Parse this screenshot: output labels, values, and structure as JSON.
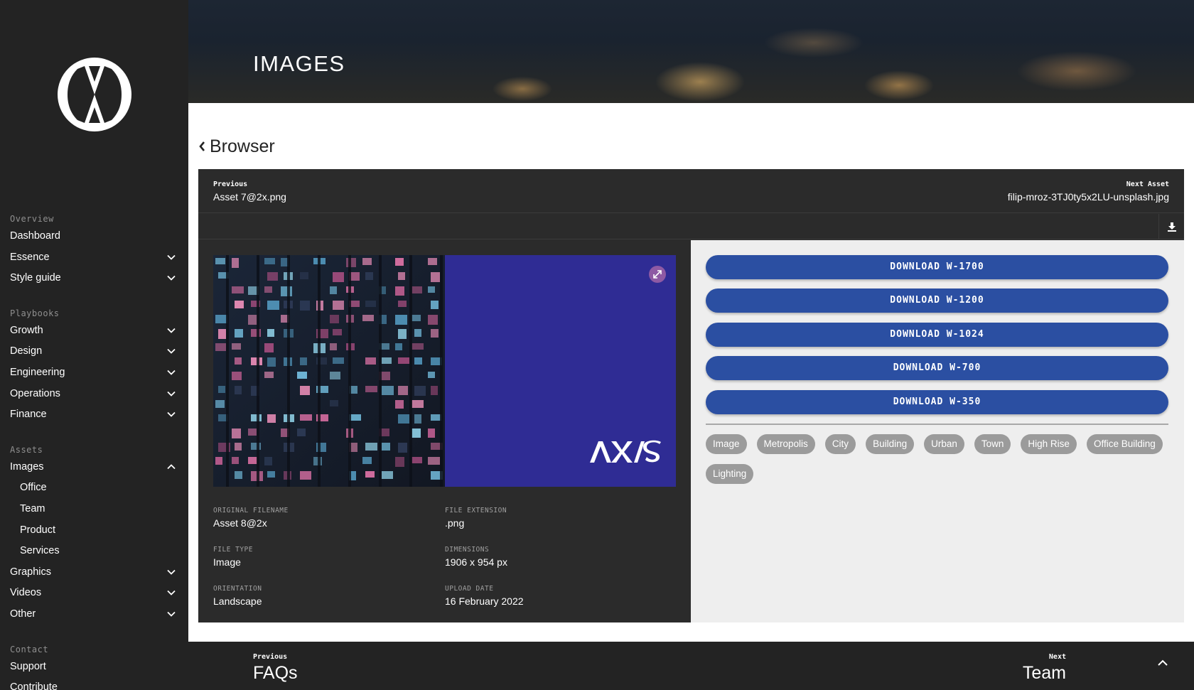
{
  "sidebar": {
    "logo": "brand-logo",
    "groups": [
      {
        "title": "Overview",
        "items": [
          {
            "label": "Dashboard",
            "chevron": ""
          },
          {
            "label": "Essence",
            "chevron": "down"
          },
          {
            "label": "Style guide",
            "chevron": "down"
          }
        ]
      },
      {
        "title": "Playbooks",
        "items": [
          {
            "label": "Growth",
            "chevron": "down"
          },
          {
            "label": "Design",
            "chevron": "down"
          },
          {
            "label": "Engineering",
            "chevron": "down"
          },
          {
            "label": "Operations",
            "chevron": "down"
          },
          {
            "label": "Finance",
            "chevron": "down"
          }
        ]
      },
      {
        "title": "Assets",
        "items": [
          {
            "label": "Images",
            "chevron": "up"
          },
          {
            "label": "Office",
            "sub": true
          },
          {
            "label": "Team",
            "sub": true
          },
          {
            "label": "Product",
            "sub": true
          },
          {
            "label": "Services",
            "sub": true
          },
          {
            "label": "Graphics",
            "chevron": "down"
          },
          {
            "label": "Videos",
            "chevron": "down"
          },
          {
            "label": "Other",
            "chevron": "down"
          }
        ]
      },
      {
        "title": "Contact",
        "items": [
          {
            "label": "Support",
            "chevron": ""
          },
          {
            "label": "Contribute",
            "chevron": ""
          }
        ]
      }
    ]
  },
  "hero": {
    "title": "IMAGES"
  },
  "browser": {
    "back_label": "Browser"
  },
  "asset_nav": {
    "previous_label": "Previous",
    "previous_name": "Asset 7@2x.png",
    "next_label": "Next Asset",
    "next_name": "filip-mroz-3TJ0ty5x2LU-unsplash.jpg"
  },
  "preview": {
    "logo_text": "AXIS"
  },
  "meta": [
    {
      "label": "ORIGINAL FILENAME",
      "value": "Asset 8@2x"
    },
    {
      "label": "FILE EXTENSION",
      "value": ".png"
    },
    {
      "label": "FILE TYPE",
      "value": "Image"
    },
    {
      "label": "DIMENSIONS",
      "value": "1906 x 954 px"
    },
    {
      "label": "ORIENTATION",
      "value": "Landscape"
    },
    {
      "label": "UPLOAD DATE",
      "value": "16 February 2022"
    }
  ],
  "downloads": [
    "DOWNLOAD W-1700",
    "DOWNLOAD W-1200",
    "DOWNLOAD W-1024",
    "DOWNLOAD W-700",
    "DOWNLOAD W-350"
  ],
  "tags": [
    "Image",
    "Metropolis",
    "City",
    "Building",
    "Urban",
    "Town",
    "High Rise",
    "Office Building",
    "Lighting"
  ],
  "footer": {
    "previous_label": "Previous",
    "previous_title": "FAQs",
    "next_label": "Next",
    "next_title": "Team"
  },
  "colors": {
    "sidebar_bg": "#232323",
    "accent_blue": "#2b4fa2",
    "preview_blue": "#2f2c94",
    "tag_bg": "#9b9b9b",
    "expand_purple": "#8e5aa4"
  }
}
